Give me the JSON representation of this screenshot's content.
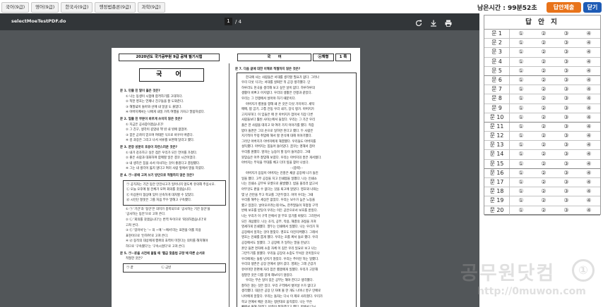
{
  "tabs": [
    "국어(9급)",
    "영어(9급)",
    "한국사(9급)",
    "행정법총론(9급)",
    "과학(9급)"
  ],
  "timer": "남은시간 : 99분52초",
  "submit_label": "답안제출",
  "close_label": "닫기",
  "viewer": {
    "file_name": "selectMoeTestPDF.do",
    "page_current": "1",
    "page_total": "/ 4",
    "icons": [
      "rotate-icon",
      "download-icon",
      "print-icon"
    ]
  },
  "paper": {
    "header_left": "2020년도 국가공무원 9급 공채 필기시험",
    "header_subject": "국　　어",
    "header_type": "ⓐ책형",
    "header_page": "1 쪽",
    "subject_box": "국 어",
    "left_lines": [
      {
        "k": "q",
        "t": "문 1. 민줄 친 말이 옳은 것은?"
      },
      {
        "k": "opt",
        "t": "① 나는 동생이 시험에 합격하기를 고대하다."
      },
      {
        "k": "opt",
        "t": "② 착한 영호는 언제나 친구들을 잘 도와준다."
      },
      {
        "k": "opt",
        "t": "③ 해질녘이 돌아와 산에 내 얼굴 도 붉었다."
      },
      {
        "k": "opt",
        "t": "④ 아버지께서는 나에게 내일 가족 여행을 가자고 말씀하셨다."
      },
      {
        "k": "q",
        "t": "문 2. 밑줄 친 부분이 바르게 쓰이지 않은 것은?"
      },
      {
        "k": "opt",
        "t": "① 지금은 공사중이겠습니다?"
      },
      {
        "k": "opt",
        "t": "② 그 친구, 생각이 깊었네 책 밖 내 밖에 없었어."
      },
      {
        "k": "opt",
        "t": "③ 꿈은 곧까지 믿으며 여태한 식으로 바꾸어 버렸다."
      },
      {
        "k": "opt",
        "t": "④ 김 과장은 그리고 나서 서류를 보완해 달라고 했다."
      },
      {
        "k": "q",
        "t": "문 3. 문장 성분의 호응이 자연스러운 것은?"
      },
      {
        "k": "opt",
        "t": "① 내가 강조하고 싶은 점은 우리가 모든 언어를 가졌다."
      },
      {
        "k": "opt",
        "t": "② 좋은 사람과 대화하며 함께할 일은 결코 시간이었다."
      },
      {
        "k": "opt",
        "t": "③ 내 생각은 집을 사서 이사하는 것이 좋겠다고 결정했다."
      },
      {
        "k": "opt",
        "t": "④ 그는 내 생각이 옳지 않다고 여러 사람 앞에서 말을 하였다."
      },
      {
        "k": "q",
        "t": "문 4. ㉠~㉣에 고쳐 쓰기 방안으로 적절하지 않은 것은?"
      },
      {
        "k": "box",
        "t": "㉠ 공직자는 기간 동안 안전사고가 일어나지 않도록 유의해 주십시오."
      },
      {
        "k": "box",
        "t": "㉡ 오늘 오후에 될 전체가 모여 회의를 갖겠습니다."
      },
      {
        "k": "box",
        "t": "㉢ 이상훈이 협상에 있어 신속하게 대처할 수 있었다."
      },
      {
        "k": "box",
        "t": "㉣ 시민단 잘못은 그를 처음 부수 말해고 구속했다."
      },
      {
        "k": "opt",
        "t": "① ㉠ '기간'과 '동안'은 의미가 중복되므로 '공사하는 기간 동안'을"
      },
      {
        "k": "opt",
        "t": "'공사하는 동안'으로 고쳐 쓴다."
      },
      {
        "k": "opt",
        "t": "② ㉡ '회의를 갖겠습니다'는 번역 투이므로 '회의하겠습니다'로"
      },
      {
        "k": "opt",
        "t": "고쳐 쓴다."
      },
      {
        "k": "opt",
        "t": "③ ㉢ '있어서'는 '~ 의 ~에 '~에서'라는 표현을 이룰 지용"
      },
      {
        "k": "opt",
        "t": "표현이므로 '인하여'로 고쳐 쓴다."
      },
      {
        "k": "opt",
        "t": "④ ㉣ 동작의 대상에게 행위의 효력이 미친다는 의미를 해치해야"
      },
      {
        "k": "opt",
        "t": "하므로 '구속했다'는 '구속시켰다'로 고쳐 쓴다."
      },
      {
        "k": "q",
        "t": "문 5. ㉠~㉣을 사전에 올릴 때 '펼급 맞춤법 규정'에 따른 순서로"
      },
      {
        "k": "opt",
        "t": "적절한 것은?"
      },
      {
        "k": "box",
        "t": "㉠ 끝　　　　　　　　　㉡ 금빈"
      }
    ],
    "right_lines": [
      {
        "k": "q",
        "t": "문 7. 다음 글에 대한 이해로 적절하지 않은 것은?"
      },
      {
        "k": "para",
        "t": "한국에 사는 사람들은 서대를 생각할 필요가 없다. 그러나"
      },
      {
        "k": "l",
        "t": "우리 다섯 식구는 서대를 살펴본 뒤 곧장 생각했다. 단"
      },
      {
        "k": "l",
        "t": "하루라도 천국을 생각해 보고 싶은 날이 없다. 하루하루의"
      },
      {
        "k": "l",
        "t": "생활이 바쁘고 어지럽다. 우리의 생활은 전쟁과 같았다."
      },
      {
        "k": "l",
        "t": "우리는 그 전쟁에서 살아야 하기 때문이다."
      },
      {
        "k": "para",
        "t": "아버지가 병원을 향해 쇄 온 것은 다섯 가지이다. 세탁"
      },
      {
        "k": "l",
        "t": "매매, 밥 굽기, 고통 전동 우리 내기, 장식 평가. 아버지가"
      },
      {
        "k": "l",
        "t": "고지자하다. 이 임들은 매 온 아버지가 잡아서 직장 다른"
      },
      {
        "k": "l",
        "t": "사람들보다 훨씬 사이는에서 들었다. 우리는 그 기간 우리"
      },
      {
        "k": "l",
        "t": "풀은 한 사람을 데리고 와 여러 가지 이야기를 했다. 적증"
      },
      {
        "k": "l",
        "t": "밥이 돌면은 그의 손으로 일하면 된다고 했다. 두 사람은"
      },
      {
        "k": "l",
        "t": "지기적이 무정 취업에 해서 할 먼식에 대해 이야기했다."
      },
      {
        "k": "l",
        "t": "그러던 아버지가 아버지에게 해결했다. 우리들도 아버지를"
      },
      {
        "k": "l",
        "t": "설득했다. 아버지는 힘들어 돌이었다. 꿈꾸는 명해서 잡아"
      },
      {
        "k": "l",
        "t": "우리를 원했다. 앞자는 능동이 할 동이 들어갔다. 그때"
      },
      {
        "k": "l",
        "t": "못맞습은 아주 잘맞해 보였다. 우리는 아버지의 훗은 게서웠다."
      },
      {
        "k": "l",
        "t": "아버지는 무덕을 무대를 베고 더미 잎을 찾아 나섰다."
      },
      {
        "k": "c",
        "t": "- (중략) -"
      },
      {
        "k": "para",
        "t": "아버지가 응답이 아버지는 진흥은 채굴 공장에 나가 들진"
      },
      {
        "k": "l",
        "t": "일을 했다. 고무 공장을 지고 인쇄짬을 일했다. 나는 인쇄소"
      },
      {
        "k": "l",
        "t": "나는 인쇄소 공무루 포켓으로 출발했다. 밤을 올리러 없고서"
      },
      {
        "k": "l",
        "t": "아무것도 판을 수 없다는 것을 퇴고에 알았다. 영호와 나와는"
      },
      {
        "k": "l",
        "t": "몇 넌 간만을 무고 학교를 그만두었다. 아마 우리는 그때"
      },
      {
        "k": "l",
        "t": "우리를 해주는 세상은 없었다. 우리는 보수가 높은 노동을"
      },
      {
        "k": "l",
        "t": "했고 있었다. 날아오르려는데 아뇨, 한주말들이 허청형 구역"
      },
      {
        "k": "l",
        "t": "반에 보호를 받듯이 우리는 이든 공안으로서 보호를 받았다."
      },
      {
        "k": "l",
        "t": "나는 우리가 이 구역 안에서 알 부호 있기를 바랐다. 그러면서"
      },
      {
        "k": "l",
        "t": "모든 개삼됐다. 나는 조직, 공부, 작용, 해결의 과정을 거쳐"
      },
      {
        "k": "l",
        "t": "영세하게 인쇄했다. 열두는 인쇄에서 일했다. 나는 우리가 허"
      },
      {
        "k": "l",
        "t": "공장에서 일하는 것이 잘맞다. 영호도 이전지켜했다. 그래서"
      },
      {
        "k": "l",
        "t": "영호는 인쇄를 뽑게 했다. 우리는 조를 짜서 들로 했다. 우리"
      },
      {
        "k": "l",
        "t": "공장에서도 일했다. 그 공장에 가 일하는 말을 만났다."
      },
      {
        "k": "l",
        "t": "혼인 들면 면자에 소중 자체 이 길은 우리 일요로 보고 나는"
      },
      {
        "k": "l",
        "t": "그만두기를 원했다. 우리들 공장의 소중도 무서운 것이었으나"
      },
      {
        "k": "l",
        "t": "우리에게는 들킬 넌지기 않았다. 우리는 주어진 하는 일했다."
      },
      {
        "k": "l",
        "t": "우리의 생존은 공장 안에서 걸어 갔다. 영회는 그래 곤갔가"
      },
      {
        "k": "l",
        "t": "유아마한 한편에 자리 잡은 했겠에게 일했다. 우리가 고문해"
      },
      {
        "k": "l",
        "t": "정말한 것은 다를 양게 해보이기 않았다."
      },
      {
        "k": "para",
        "t": "우리는 무슨 일이 있든 공부는 해야 한다고 생각했다."
      },
      {
        "k": "l",
        "t": "잘하든 않는 것은 있다. 우리 구역에서 벗어날 수가 없다고"
      },
      {
        "k": "l",
        "t": "생각했다. 대운은 공장 단 자에 볼 한 개도 나이나 영구 인배로"
      },
      {
        "k": "l",
        "t": "나아에게 알맞다. 우리는 돌자는 다시 이 제로 사라졌다. 우리가"
      },
      {
        "k": "l",
        "t": "학교 안에서 배운 것과는 정반대로 움직였다. 나는 무슨"
      },
      {
        "k": "l",
        "t": "뼈에서 원해 하였다. 빈종이 잘하였다고 했다. 박에서 다시"
      },
      {
        "k": "l",
        "t": "다르게는 전을 한다 입고 원고의 다른 우리가 했다."
      }
    ]
  },
  "sheet": {
    "title": "답 안 지",
    "options": [
      "①",
      "②",
      "③",
      "④"
    ],
    "rows": [
      "문 1",
      "문 2",
      "문 3",
      "문 4",
      "문 5",
      "문 6",
      "문 7",
      "문 8",
      "문 9",
      "문 10",
      "문 11",
      "문 12",
      "문 13",
      "문 14",
      "문 15",
      "문 16",
      "문 17",
      "문 18",
      "문 19",
      "문 20"
    ]
  },
  "watermark": {
    "text": "공무원닷컴",
    "url": "http://0muwon.com",
    "logo_text": "①"
  },
  "colors": {
    "submit": "#e8731a",
    "close": "#1e5bb5",
    "viewer_bg": "#525659",
    "toolbar_bg": "#323639"
  }
}
